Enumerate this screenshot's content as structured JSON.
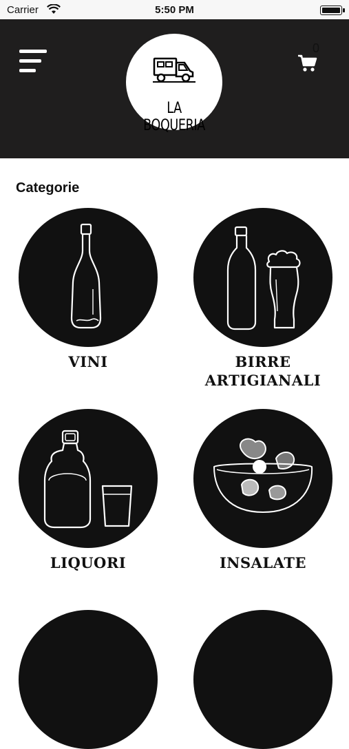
{
  "status_bar": {
    "carrier": "Carrier",
    "time": "5:50 PM"
  },
  "header": {
    "logo_text": "LA BOQUERIA",
    "cart_count": "0"
  },
  "section": {
    "title": "Categorie"
  },
  "categories": [
    {
      "label": "VINI",
      "icon": "wine-bottle-icon"
    },
    {
      "label": "BIRRE\nARTIGIANALI",
      "icon": "beer-icon"
    },
    {
      "label": "LIQUORI",
      "icon": "liquor-icon"
    },
    {
      "label": "INSALATE",
      "icon": "salad-bowl-icon"
    }
  ]
}
